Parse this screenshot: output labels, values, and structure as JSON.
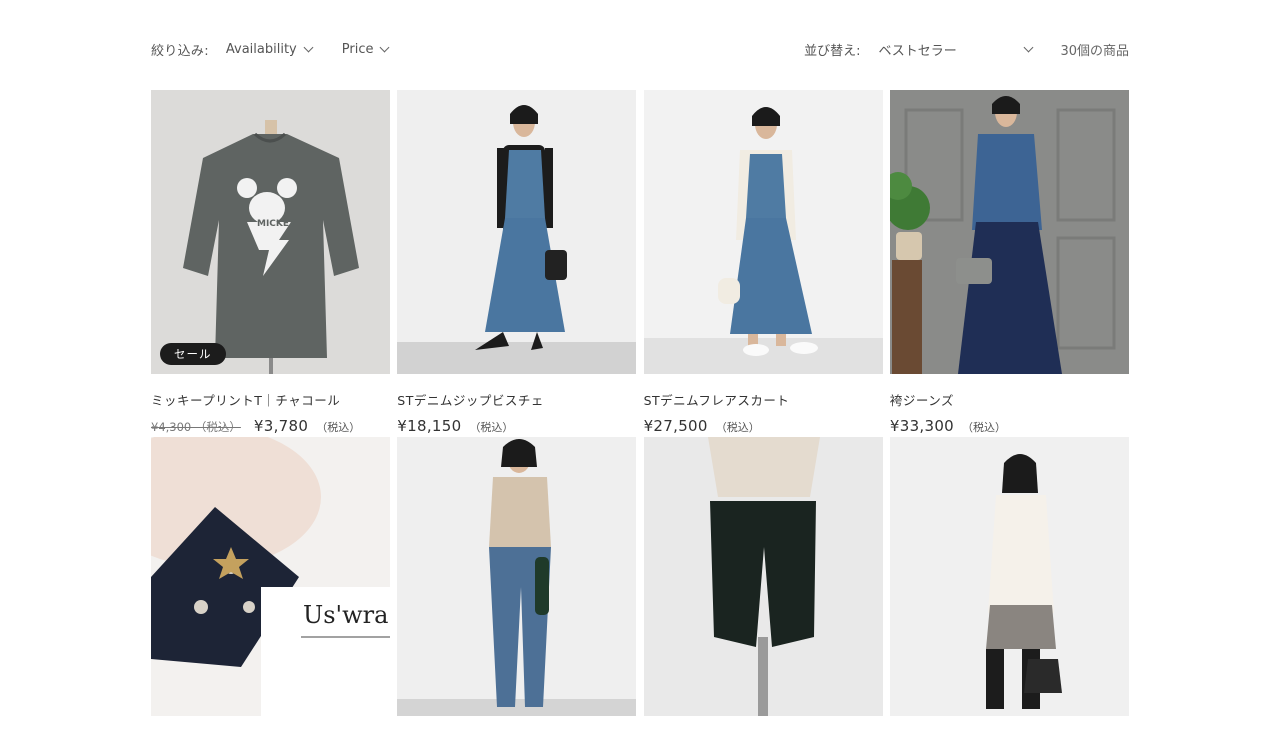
{
  "filters": {
    "label": "絞り込み:",
    "availability": "Availability",
    "price": "Price"
  },
  "sort": {
    "label": "並び替え:",
    "value": "ベストセラー"
  },
  "product_count": "30個の商品",
  "products_row1": [
    {
      "title": "ミッキープリントT｜チャコール",
      "old_price": "¥4,300 （税込）",
      "price": "¥3,780",
      "tax": "（税込）",
      "badge": "セール"
    },
    {
      "title": "STデニムジップビスチェ",
      "price": "¥18,150",
      "tax": "（税込）"
    },
    {
      "title": "STデニムフレアスカート",
      "price": "¥27,500",
      "tax": "（税込）"
    },
    {
      "title": "袴ジーンズ",
      "price": "¥33,300",
      "tax": "（税込）"
    }
  ],
  "image_text": {
    "tshirt_print": "MICKEY",
    "brand_card": "Us'wra"
  },
  "colors": {
    "text": "#333333",
    "badge_bg": "#1c1c1c",
    "badge_text": "#ffffff"
  }
}
